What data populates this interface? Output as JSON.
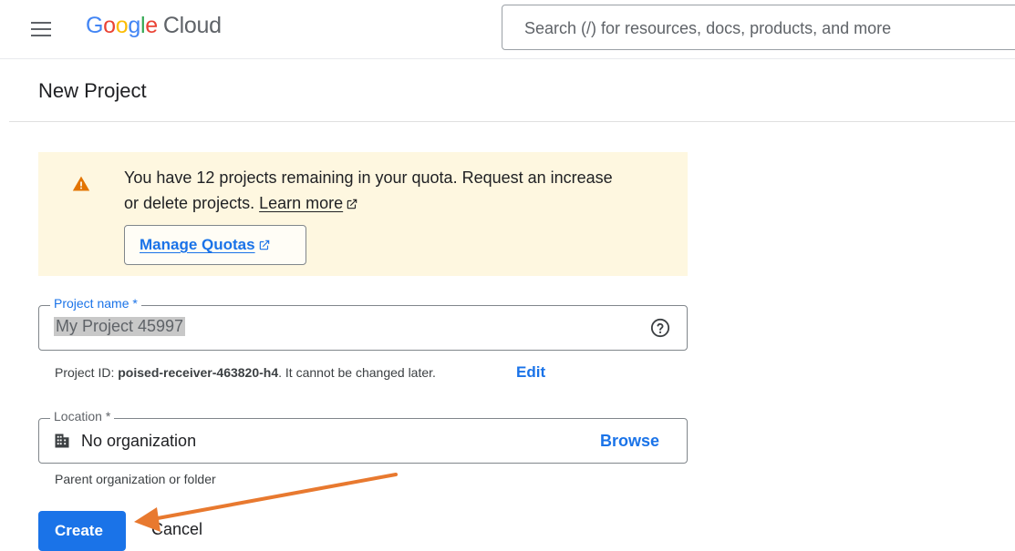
{
  "header": {
    "logo_letters": [
      "G",
      "o",
      "o",
      "g",
      "l",
      "e"
    ],
    "logo_product": "Cloud",
    "search_placeholder": "Search (/) for resources, docs, products, and more"
  },
  "page": {
    "title": "New Project"
  },
  "quota_banner": {
    "line1": "You have 12 projects remaining in your quota. Request an increase",
    "line2": "or delete projects.",
    "learn_more": "Learn more",
    "manage_quotas": "Manage Quotas"
  },
  "project_name_field": {
    "label": "Project name *",
    "value": "My Project 45997"
  },
  "project_id_hint": {
    "prefix": "Project ID: ",
    "id": "poised-receiver-463820-h4",
    "suffix": ". It cannot be changed later.",
    "edit": "Edit"
  },
  "location_field": {
    "label": "Location *",
    "value": "No organization",
    "browse": "Browse",
    "hint": "Parent organization or folder"
  },
  "actions": {
    "create": "Create",
    "cancel": "Cancel"
  },
  "colors": {
    "primary": "#1a73e8",
    "banner_bg": "#fef7e0",
    "warning": "#e37400",
    "annotation_arrow": "#e8792f"
  },
  "icons": {
    "menu": "hamburger-menu-icon",
    "warning": "warning-icon",
    "help": "help-circle-icon",
    "building": "building-icon",
    "external": "external-link-icon"
  }
}
